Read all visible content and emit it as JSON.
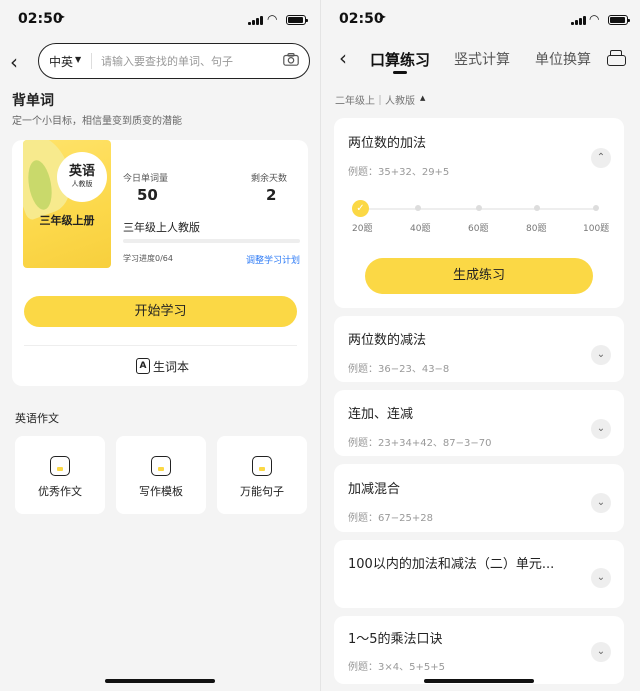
{
  "left": {
    "status": {
      "time": "02:50"
    },
    "search": {
      "lang": "中英",
      "placeholder": "请输入要查找的单词、句子"
    },
    "vocab_section": {
      "title": "背单词",
      "subtitle": "定一个小目标，相信量变到质变的潜能"
    },
    "book": {
      "badge_title": "英语",
      "badge_sub": "人教版",
      "cover_title": "三年级上册"
    },
    "stats": {
      "today_label": "今日单词量",
      "today_value": "50",
      "days_label": "剩余天数",
      "days_value": "2"
    },
    "edition": "三年级上人教版",
    "progress": {
      "text": "学习进度0/64",
      "fraction": 0,
      "adjust_link": "调整学习计划"
    },
    "start_button": "开始学习",
    "wordbook": "生词本",
    "composition": {
      "title": "英语作文",
      "tiles": [
        {
          "label": "优秀作文",
          "icon": "excellent-essay-icon"
        },
        {
          "label": "写作模板",
          "icon": "writing-template-icon"
        },
        {
          "label": "万能句子",
          "icon": "universal-sentence-icon"
        }
      ]
    }
  },
  "right": {
    "status": {
      "time": "02:50"
    },
    "tabs": [
      "口算练习",
      "竖式计算",
      "单位换算"
    ],
    "active_tab": 0,
    "grade": "二年级上｜人教版",
    "topics": [
      {
        "title": "两位数的加法",
        "example": "例题：35+32、29+5",
        "expanded": true
      },
      {
        "title": "两位数的减法",
        "example": "例题：36−23、43−8"
      },
      {
        "title": "连加、连减",
        "example": "例题：23+34+42、87−3−70"
      },
      {
        "title": "加减混合",
        "example": "例题：67−25+28"
      },
      {
        "title": "100以内的加法和减法（二）单元...",
        "example": ""
      },
      {
        "title": "1～5的乘法口诀",
        "example": "例题：3×4、5+5+5"
      }
    ],
    "slider": {
      "options": [
        "20题",
        "40题",
        "60题",
        "80题",
        "100题"
      ],
      "selected": "20题"
    },
    "generate_button": "生成练习"
  }
}
